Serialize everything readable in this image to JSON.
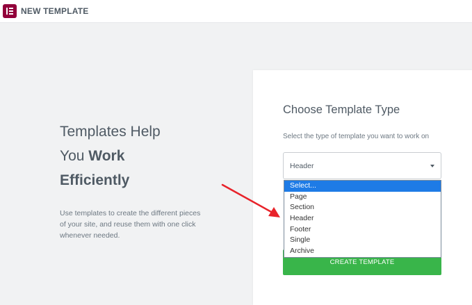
{
  "app": {
    "title": "NEW TEMPLATE",
    "logo_icon": "elementor-logo-icon",
    "brand_color": "#92003b"
  },
  "hero": {
    "line1": "Templates Help",
    "line2_prefix": "You ",
    "line2_bold": "Work",
    "line3_bold": "Efficiently",
    "description": "Use templates to create the different pieces of your site, and reuse them with one click whenever needed."
  },
  "form": {
    "title": "Choose Template Type",
    "label": "Select the type of template you want to work on",
    "selected_value": "Header",
    "options": [
      "Select...",
      "Page",
      "Section",
      "Header",
      "Footer",
      "Single",
      "Archive"
    ],
    "highlighted_option": "Select...",
    "submit_label": "CREATE TEMPLATE",
    "submit_color": "#39b54a",
    "highlight_color": "#1e7be6"
  },
  "annotation": {
    "arrow_color": "#e8232a"
  }
}
